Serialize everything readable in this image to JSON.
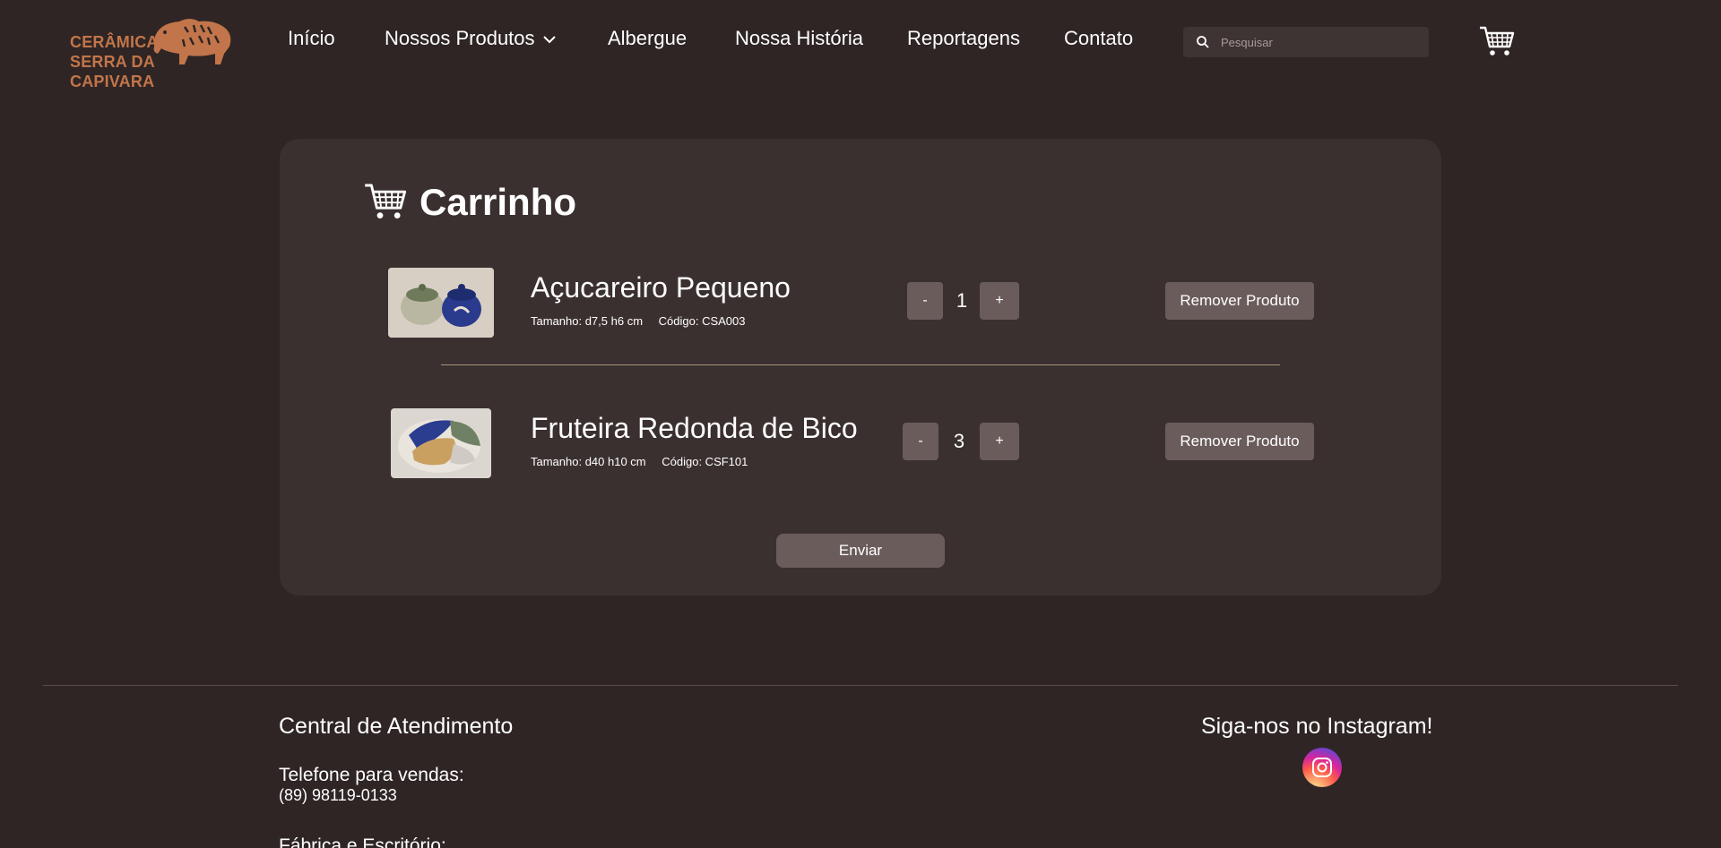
{
  "header": {
    "logo_line1": "CERÂMICA",
    "logo_line2": "SERRA DA CAPIVARA",
    "nav": [
      {
        "label": "Início"
      },
      {
        "label": "Nossos Produtos"
      },
      {
        "label": "Albergue"
      },
      {
        "label": "Nossa História"
      },
      {
        "label": "Reportagens"
      },
      {
        "label": "Contato"
      }
    ],
    "search_placeholder": "Pesquisar",
    "cart_icon": "cart-icon"
  },
  "cart": {
    "title": "Carrinho",
    "items": [
      {
        "name": "Açucareiro Pequeno",
        "size": "Tamanho: d7,5 h6 cm",
        "code": "Código: CSA003",
        "minus": "-",
        "qty": "1",
        "plus": "+",
        "remove": "Remover Produto"
      },
      {
        "name": "Fruteira Redonda de Bico",
        "size": "Tamanho: d40 h10 cm",
        "code": "Código: CSF101",
        "minus": "-",
        "qty": "3",
        "plus": "+",
        "remove": "Remover Produto"
      }
    ],
    "send_label": "Enviar"
  },
  "footer": {
    "service_title": "Central de Atendimento",
    "phone_label": "Telefone para vendas:",
    "phone": "(89) 98119-0133",
    "factory_label": "Fábrica e Escritório:",
    "instagram_title": "Siga-nos no Instagram!"
  },
  "colors": {
    "background": "#2f2525",
    "panel": "#3b3030",
    "button": "#6b5c5c",
    "logo": "#c2754a"
  }
}
